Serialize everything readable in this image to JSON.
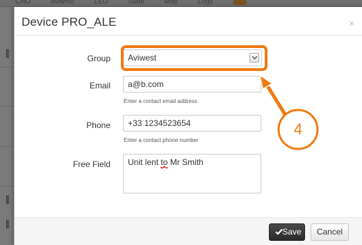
{
  "background": {
    "topbar_items": [
      "CHO",
      "Aviwest",
      "LEO",
      "State",
      "Map",
      "Logs"
    ]
  },
  "dialog": {
    "title": "Device PRO_ALE",
    "close_glyph": "×"
  },
  "form": {
    "group": {
      "label": "Group",
      "value": "Aviwest"
    },
    "email": {
      "label": "Email",
      "value": "a@b.com",
      "help": "Enter a contact email address"
    },
    "phone": {
      "label": "Phone",
      "value": "+33 1234523654",
      "help": "Enter a contact phone number"
    },
    "free_field": {
      "label": "Free Field",
      "value_prefix": "Unit lent ",
      "value_misspelled": "to",
      "value_suffix": " Mr Smith"
    }
  },
  "footer": {
    "save_label": "Save",
    "cancel_label": "Cancel"
  },
  "annotation": {
    "number": "4",
    "color": "#f07a12"
  }
}
